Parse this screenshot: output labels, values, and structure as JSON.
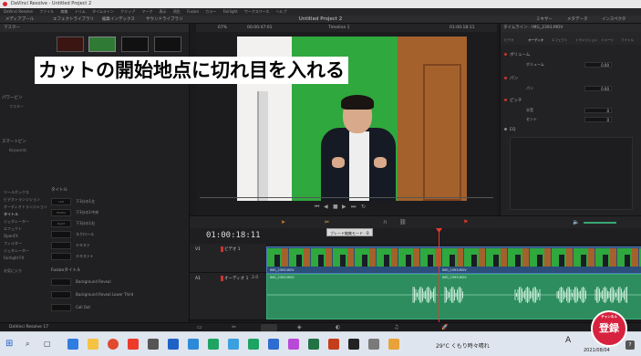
{
  "window": {
    "title": "DaVinci Resolve - Untitled Project 2",
    "menu": [
      "DaVinci Resolve",
      "ファイル",
      "編集",
      "トリム",
      "タイムライン",
      "クリップ",
      "マーク",
      "表示",
      "再生",
      "Fusion",
      "カラー",
      "Fairlight",
      "ワークスペース",
      "ヘルプ"
    ]
  },
  "toolbar": {
    "media_pool": "メディアプール",
    "effects_library": "エフェクトライブラリ",
    "edit_index": "編集インデックス",
    "sound_library": "サウンドライブラリ",
    "project_title": "Untitled Project 2",
    "mixer": "ミキサー",
    "metadata": "メタデータ",
    "inspector": "インスペクタ"
  },
  "media_panel": {
    "header": "マスター",
    "sections": [
      "マスター",
      "パワービン",
      "マスター",
      "スマートビン",
      "Keywords"
    ]
  },
  "effects_panel": {
    "tree": [
      "ツールボックス",
      "ビデオトランジション",
      "オーディオトランジション",
      "タイトル",
      "ジェネレーター",
      "エフェクト",
      "OpenFX",
      "フィルター",
      "ジェネレーター",
      "Fairlight FX",
      "お気に入り"
    ],
    "header_titles": "タイトル",
    "items": [
      {
        "swatch": "Left",
        "label": "下3分の1左"
      },
      {
        "swatch": "Middle",
        "label": "下3分の1中央"
      },
      {
        "swatch": "Right",
        "label": "下3分の1右"
      },
      {
        "swatch": "",
        "label": "スクロール"
      },
      {
        "swatch": "",
        "label": "テキスト"
      },
      {
        "swatch": "",
        "label": "テキスト+"
      }
    ],
    "fusion_header": "Fusionタイトル",
    "fusion_items": [
      "Background Reveal",
      "Background Reveal Lower Third",
      "Call Out"
    ]
  },
  "viewer": {
    "zoom": "67%",
    "source_timecode": "00:00:47:01",
    "timeline_name": "Timeline 1",
    "record_timecode": "01:00:18:11",
    "caption": "カットの開始地点に切れ目を入れる"
  },
  "inspector": {
    "header": "タイムライン - IMG_2393.MOV",
    "tabs": [
      "ビデオ",
      "オーディオ",
      "エフェクト",
      "トランジション",
      "イメージ",
      "ファイル"
    ],
    "volume_label": "ボリューム",
    "volume_sub": "ボリューム",
    "volume_value": "0.00",
    "pan_label": "パン",
    "pan_sub": "パン",
    "pan_value": "0.00",
    "pitch_label": "ピッチ",
    "pitch_semitones": "半音",
    "pitch_semitones_value": "0",
    "pitch_cents": "セント",
    "pitch_cents_value": "0",
    "eq_label": "EQ"
  },
  "timeline": {
    "timecode": "01:00:18:11",
    "tooltip": "ブレード編集モード - B",
    "video_track": "ビデオ 1",
    "video_track_id": "V1",
    "audio_track": "オーディオ 1",
    "audio_track_id": "A1",
    "audio_channel": "2.0",
    "clip_name": "IMG_2393.MOV"
  },
  "page_nav": {
    "app_label": "DaVinci Resolve 17"
  },
  "taskbar": {
    "weather": "29°C くもり時々晴れ",
    "time": "2021/08/04",
    "ime": "A",
    "notif_count": "7"
  },
  "stamp": {
    "text": "登録",
    "sub": "チャンネル"
  },
  "colors": {
    "playhead": "#e53a2e",
    "video_clip": "#2b4e7a",
    "audio_clip": "#2e8d5e"
  }
}
